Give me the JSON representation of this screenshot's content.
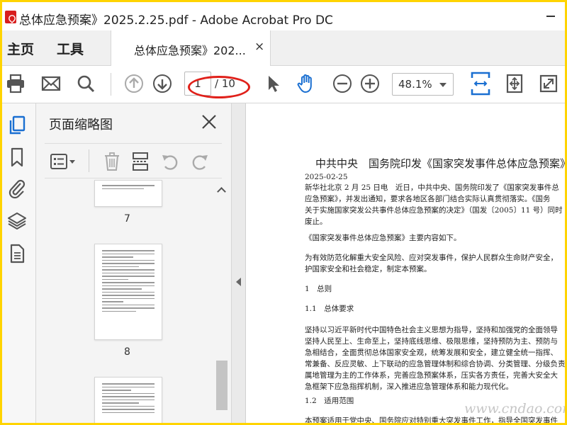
{
  "window": {
    "title": "总体应急预案》2025.2.25.pdf - Adobe Acrobat Pro DC"
  },
  "nav": {
    "home": "主页",
    "tools": "工具",
    "doc_tab_label": "总体应急预案》202...",
    "doc_tab_close": "×"
  },
  "toolbar": {
    "current_page": "1",
    "total_pages": "/ 10",
    "zoom": "48.1%",
    "icons": [
      "print-icon",
      "email-icon",
      "search-icon",
      "page-up-icon",
      "page-down-icon",
      "select-arrow-icon",
      "hand-icon",
      "zoom-out-icon",
      "zoom-in-icon",
      "fit-width-icon",
      "fit-page-icon",
      "full-screen-icon"
    ],
    "accent_color": "#1a6fd1"
  },
  "rail": {
    "icons": [
      "pages-icon",
      "bookmark-icon",
      "attachment-icon",
      "layers-icon",
      "document-icon"
    ]
  },
  "panel": {
    "title": "页面缩略图",
    "thumbnails": [
      {
        "label": "7"
      },
      {
        "label": "8"
      },
      {
        "label": ""
      }
    ]
  },
  "document": {
    "title": "中共中央　国务院印发《国家突发事件总体应急预案》",
    "date": "2025-02-25",
    "para1": [
      "新华社北京 2 月 25 日电　近日，中共中央、国务院印发了《国家突发事件总",
      "应急预案》，并发出通知，要求各地区各部门结合实际认真贯彻落实。《国务",
      "关于实施国家突发公共事件总体应急预案的决定》（国发〔2005〕11 号）同时",
      "废止。"
    ],
    "para2": "《国家突发事件总体应急预案》主要内容如下。",
    "para3": [
      "为有效防范化解重大安全风险、应对突发事件，保护人民群众生命财产安全，",
      "护国家安全和社会稳定，制定本预案。"
    ],
    "heading1": "1　总则",
    "heading2": "1.1　总体要求",
    "para4": [
      "坚持以习近平新时代中国特色社会主义思想为指导，坚持和加强党的全面领导",
      "坚持人民至上、生命至上，坚持底线思维、极限思维，坚持预防为主、预防与",
      "急相结合，全面贯彻总体国家安全观，统筹发展和安全，建立健全统一指挥、",
      "常兼备、反应灵敏、上下联动的应急管理体制和综合协调、分类管理、分级负责",
      "属地管理为主的工作体系，完善应急预案体系，压实各方责任，完善大安全大",
      "急框架下应急指挥机制，深入推进应急管理体系和能力现代化。"
    ],
    "heading3": "1.2　适用范围",
    "para5": "本预案适用于党中央、国务院应对特别重大突发事件工作，指导全国突发事件"
  },
  "watermarks": {
    "bottom": "www.cndao.com"
  }
}
